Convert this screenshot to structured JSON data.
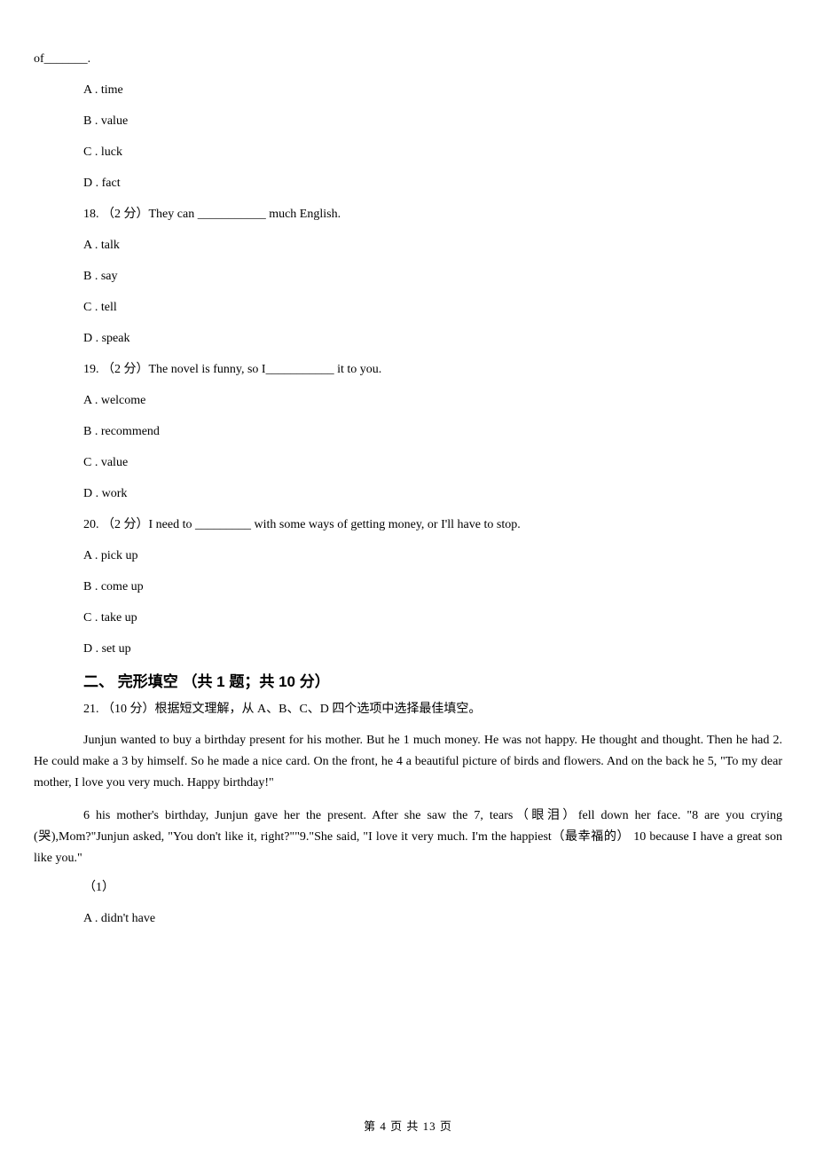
{
  "frag": {
    "text": "of_______."
  },
  "q17": {
    "A": "A . time",
    "B": "B . value",
    "C": "C . luck",
    "D": "D . fact"
  },
  "q18": {
    "stem": "18. （2 分）They can ___________ much English.",
    "A": "A . talk",
    "B": "B . say",
    "C": "C . tell",
    "D": "D . speak"
  },
  "q19": {
    "stem": "19. （2 分）The novel is funny, so I___________ it to you.",
    "A": "A . welcome",
    "B": "B . recommend",
    "C": "C . value",
    "D": "D . work"
  },
  "q20": {
    "stem": "20. （2 分）I need to _________ with some ways of getting money, or I'll have to stop.",
    "A": "A . pick up",
    "B": "B . come up",
    "C": "C . take up",
    "D": "D . set up"
  },
  "section2": {
    "heading": "二、 完形填空 （共 1 题；共 10 分）"
  },
  "q21": {
    "stem": "21. （10 分）根据短文理解，从 A、B、C、D 四个选项中选择最佳填空。",
    "para1": "Junjun wanted to buy a birthday present for his mother. But he  1 much money. He was not happy. He thought and thought. Then he had  2. He could make a  3 by himself. So he made a nice card. On the front, he  4 a beautiful picture of birds and flowers. And on the back he  5, \"To my dear mother, I love you very much. Happy birthday!\"",
    "para2": " 6 his mother's birthday, Junjun gave her the present. After she saw the  7, tears（眼泪）fell down her face. \"8 are you crying (哭),Mom?\"Junjun asked, \"You don't like it, right?\"\"9.\"She said, \"I love it very much. I'm the happiest（最幸福的）  10 because I have a great son like you.\"",
    "sub1_label": "（1）",
    "sub1_A": "A . didn't have"
  },
  "footer": {
    "text": "第 4 页 共 13 页"
  }
}
